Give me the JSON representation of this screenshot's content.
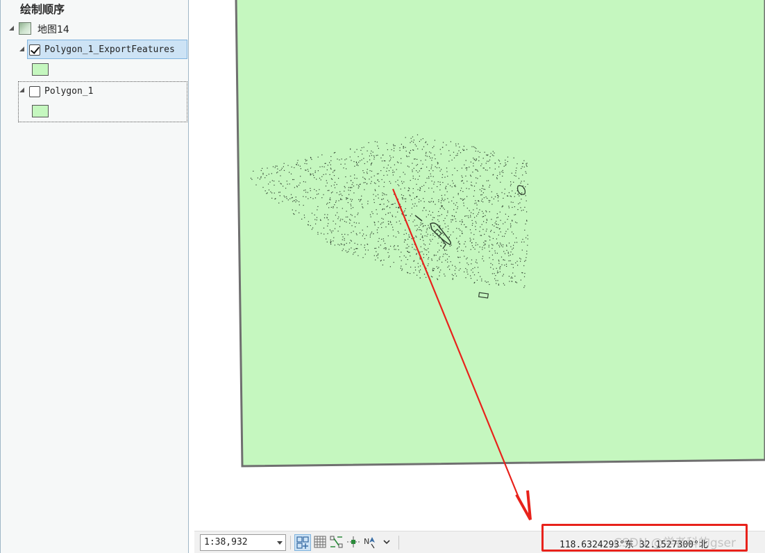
{
  "contents": {
    "title": "绘制顺序",
    "map": {
      "label": "地图14",
      "icon": "map-icon"
    },
    "layers": [
      {
        "label": "Polygon_1_ExportFeatures",
        "checked": true,
        "selected": true,
        "symbol_color": "#c5f7bf"
      },
      {
        "label": "Polygon_1",
        "checked": false,
        "selected": false,
        "symbol_color": "#c5f7bf"
      }
    ]
  },
  "map_view": {
    "polygon_fill": "#c5f7bf",
    "polygon_outline": "#6f6f6f",
    "feature_color": "#2f3f2f"
  },
  "status_bar": {
    "scale": "1:38,932",
    "coordinates": "118.6324293°东 32.1527300°北",
    "watermark": "CSDN @学者科的gser",
    "tools": [
      "grid-layout-icon",
      "grid-icon",
      "snapping-icon",
      "measure-icon",
      "north-arrow-icon",
      "chevron-down-icon"
    ]
  },
  "annotation": {
    "arrow_color": "#e8221b"
  }
}
